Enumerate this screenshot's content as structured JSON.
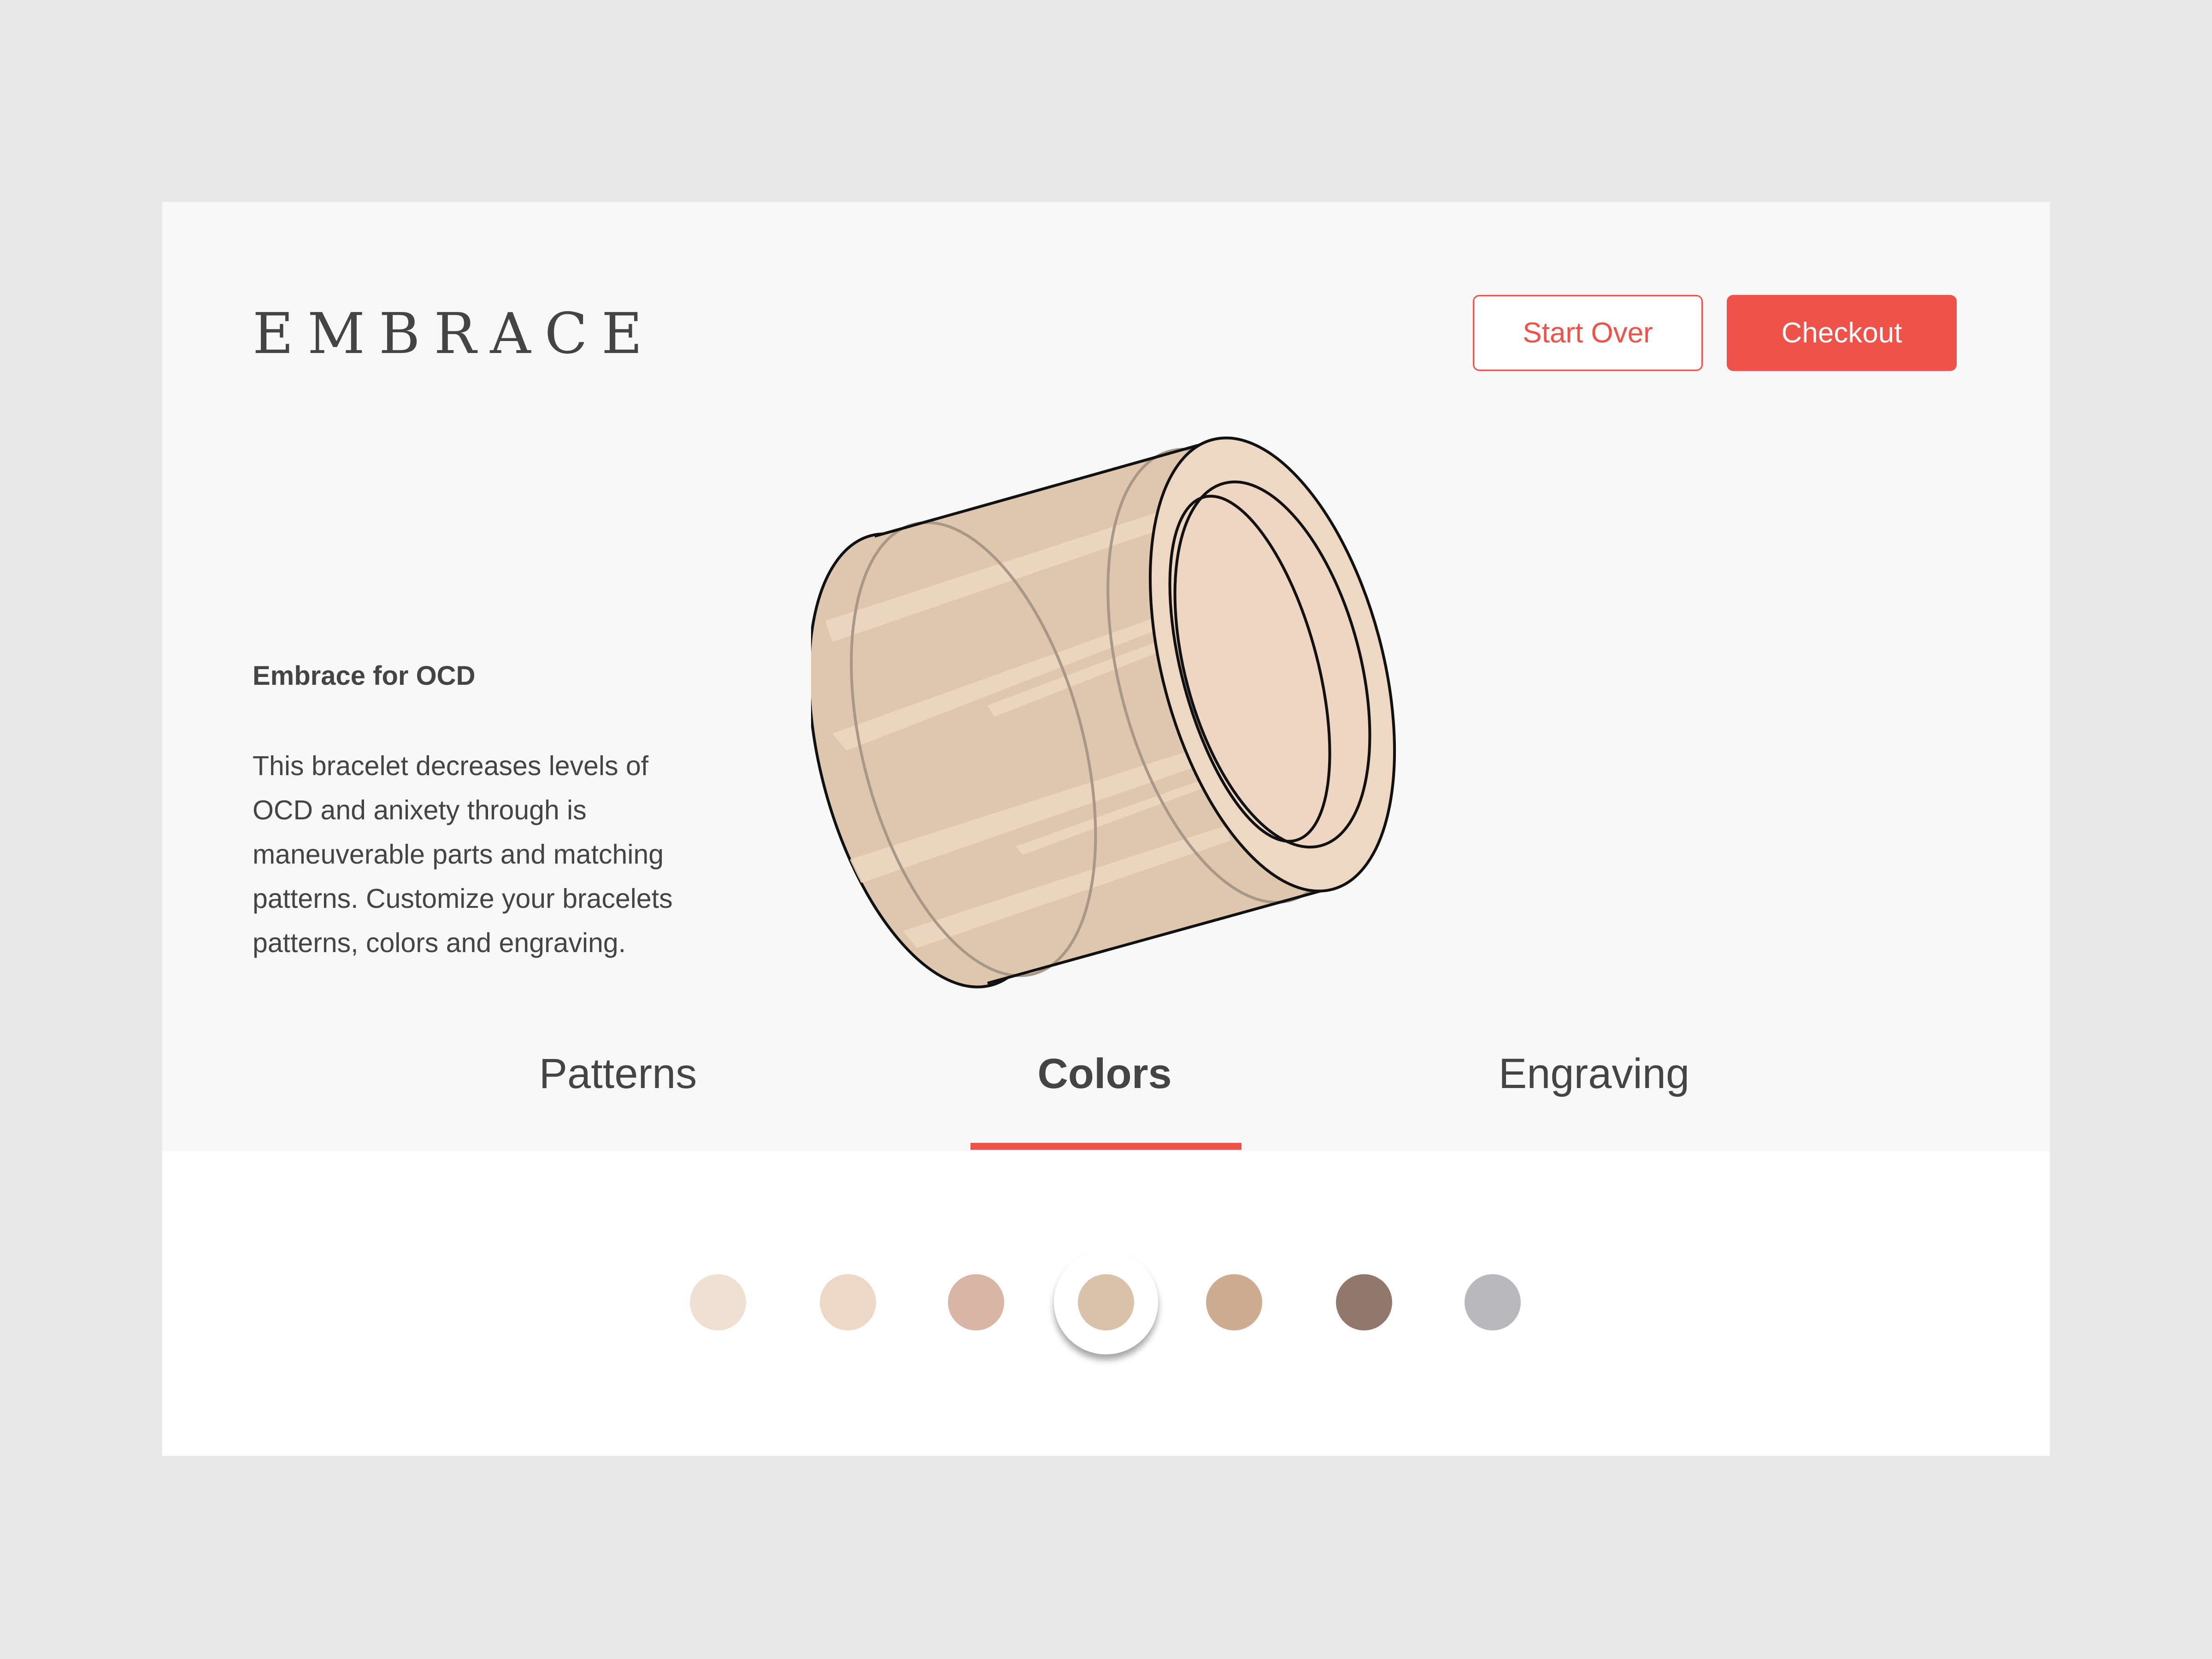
{
  "brand": "EMBRACE",
  "buttons": {
    "start_over": "Start Over",
    "checkout": "Checkout"
  },
  "product": {
    "title": "Embrace for OCD",
    "description": "This bracelet decreases levels of OCD and anixety through is maneuverable parts and matching patterns. Customize your bracelets patterns, colors and engraving."
  },
  "tabs": [
    {
      "label": "Patterns",
      "active": false
    },
    {
      "label": "Colors",
      "active": true
    },
    {
      "label": "Engraving",
      "active": false
    }
  ],
  "colors": {
    "accent": "#ef5249",
    "swatches": [
      "#eee0d3",
      "#edd8c5",
      "#d9b5a6",
      "#d9c2a9",
      "#cfab92",
      "#92786b",
      "#b9b8bd"
    ],
    "selected_index": 3,
    "bracelet_body": "#dfc6ae",
    "bracelet_face": "#eed8c4"
  }
}
